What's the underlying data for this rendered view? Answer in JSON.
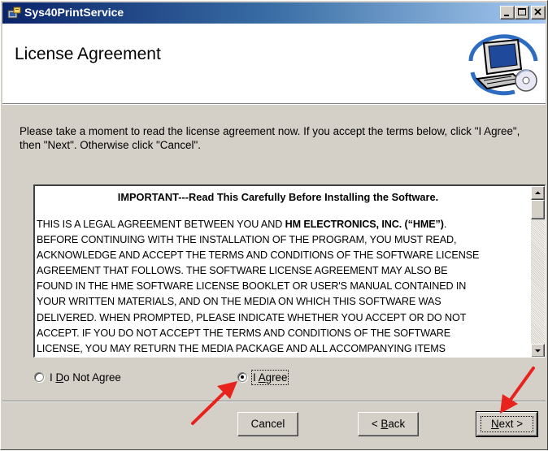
{
  "window": {
    "title": "Sys40PrintService"
  },
  "header": {
    "title": "License Agreement"
  },
  "instructions": "Please take a moment to read the license agreement now. If you accept the terms below, click \"I Agree\", then \"Next\". Otherwise click \"Cancel\".",
  "license": {
    "heading": "IMPORTANT---Read This Carefully Before Installing the Software.",
    "line1_pre": "THIS IS A LEGAL AGREEMENT BETWEEN YOU AND ",
    "line1_bold": "HM ELECTRONICS, INC. (“HME”)",
    "line1_post": ".",
    "lines": [
      "BEFORE CONTINUING WITH THE INSTALLATION OF THE PROGRAM, YOU MUST READ,",
      "ACKNOWLEDGE AND ACCEPT THE TERMS AND CONDITIONS OF THE SOFTWARE LICENSE",
      "AGREEMENT THAT FOLLOWS. THE SOFTWARE LICENSE AGREEMENT MAY ALSO BE",
      "FOUND IN THE HME SOFTWARE LICENSE BOOKLET OR USER'S MANUAL CONTAINED IN",
      "YOUR WRITTEN MATERIALS, AND ON THE MEDIA ON WHICH THIS SOFTWARE WAS",
      "DELIVERED.  WHEN PROMPTED, PLEASE INDICATE WHETHER YOU ACCEPT OR DO NOT",
      "ACCEPT.  IF YOU DO NOT ACCEPT THE TERMS AND CONDITIONS OF THE SOFTWARE",
      "LICENSE, YOU MAY RETURN THE MEDIA PACKAGE AND ALL ACCOMPANYING ITEMS"
    ]
  },
  "radios": {
    "disagree": {
      "label": "I Do Not Agree",
      "mnemonic": "D",
      "selected": false
    },
    "agree": {
      "label": "I Agree",
      "mnemonic": "A",
      "selected": true
    }
  },
  "buttons": {
    "cancel": "Cancel",
    "back": "< Back",
    "next": "Next >"
  },
  "colors": {
    "titlebar_start": "#0a246a",
    "titlebar_end": "#a6caf0",
    "dialog_face": "#d4d0c8",
    "annotation_arrow": "#e8231d"
  },
  "icons": {
    "app": "installer-icon",
    "header": "computer-cd-graphic",
    "minimize": "minimize-icon",
    "maximize": "maximize-icon",
    "close": "close-icon",
    "scroll_up": "scroll-up-arrow-icon",
    "scroll_down": "scroll-down-arrow-icon"
  }
}
